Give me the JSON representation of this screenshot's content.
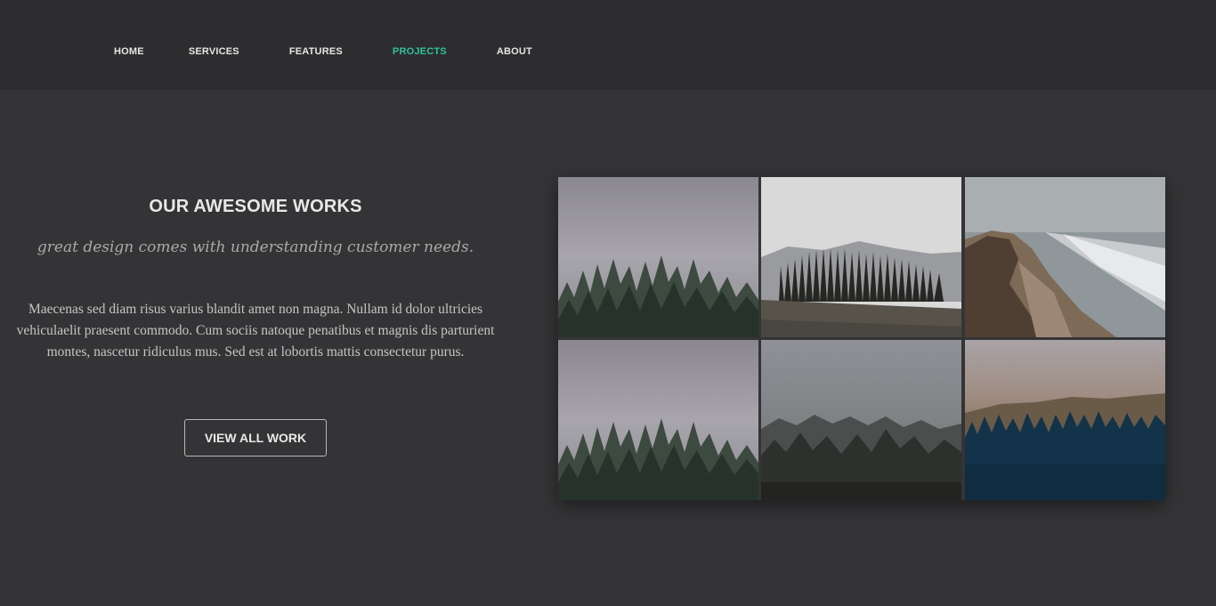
{
  "nav": {
    "items": [
      {
        "label": "HOME",
        "active": false
      },
      {
        "label": "SERVICES",
        "active": false
      },
      {
        "label": "FEATURES",
        "active": false
      },
      {
        "label": "PROJECTS",
        "active": true
      },
      {
        "label": "ABOUT",
        "active": false
      }
    ]
  },
  "hero": {
    "title": "OUR AWESOME WORKS",
    "tagline": "great design comes with understanding customer needs.",
    "body": "Maecenas sed diam risus varius blandit amet non magna. Nullam id dolor ultricies vehiculaelit praesent commodo. Cum sociis natoque penatibus et magnis dis parturient montes, nascetur ridiculus mus. Sed est at lobortis mattis consectetur purus.",
    "button_label": "VIEW ALL WORK"
  },
  "gallery": {
    "tiles": [
      {
        "subject": "misty-pine-forest-photo"
      },
      {
        "subject": "forest-hill-meadow-photo"
      },
      {
        "subject": "coastal-cliff-beach-photo"
      },
      {
        "subject": "misty-pine-forest-photo"
      },
      {
        "subject": "foggy-dark-forest-photo"
      },
      {
        "subject": "sunset-forest-silhouette-photo"
      }
    ]
  },
  "colors": {
    "accent": "#2ec29b",
    "header_bg": "#2d2d2f",
    "page_bg": "#343436"
  }
}
